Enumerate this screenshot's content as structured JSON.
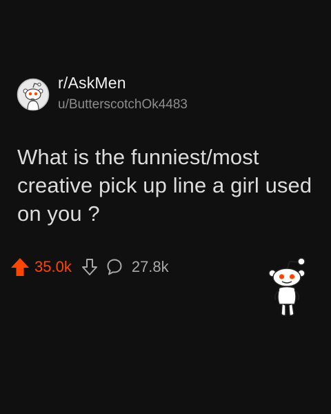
{
  "post": {
    "subreddit": "r/AskMen",
    "username": "u/ButterscotchOk4483",
    "title": "What is the funniest/most creative pick up line a girl used on you ?",
    "upvotes": "35.0k",
    "comments": "27.8k"
  },
  "icons": {
    "avatar": "snoo-avatar-icon",
    "upvote": "upvote-arrow-icon",
    "downvote": "downvote-arrow-icon",
    "comment": "comment-bubble-icon",
    "mascot": "snoo-mascot-icon"
  },
  "colors": {
    "background": "#101010",
    "upvote": "#ff4500",
    "text_primary": "#f2f2f2",
    "text_secondary": "#8e8e8e"
  }
}
